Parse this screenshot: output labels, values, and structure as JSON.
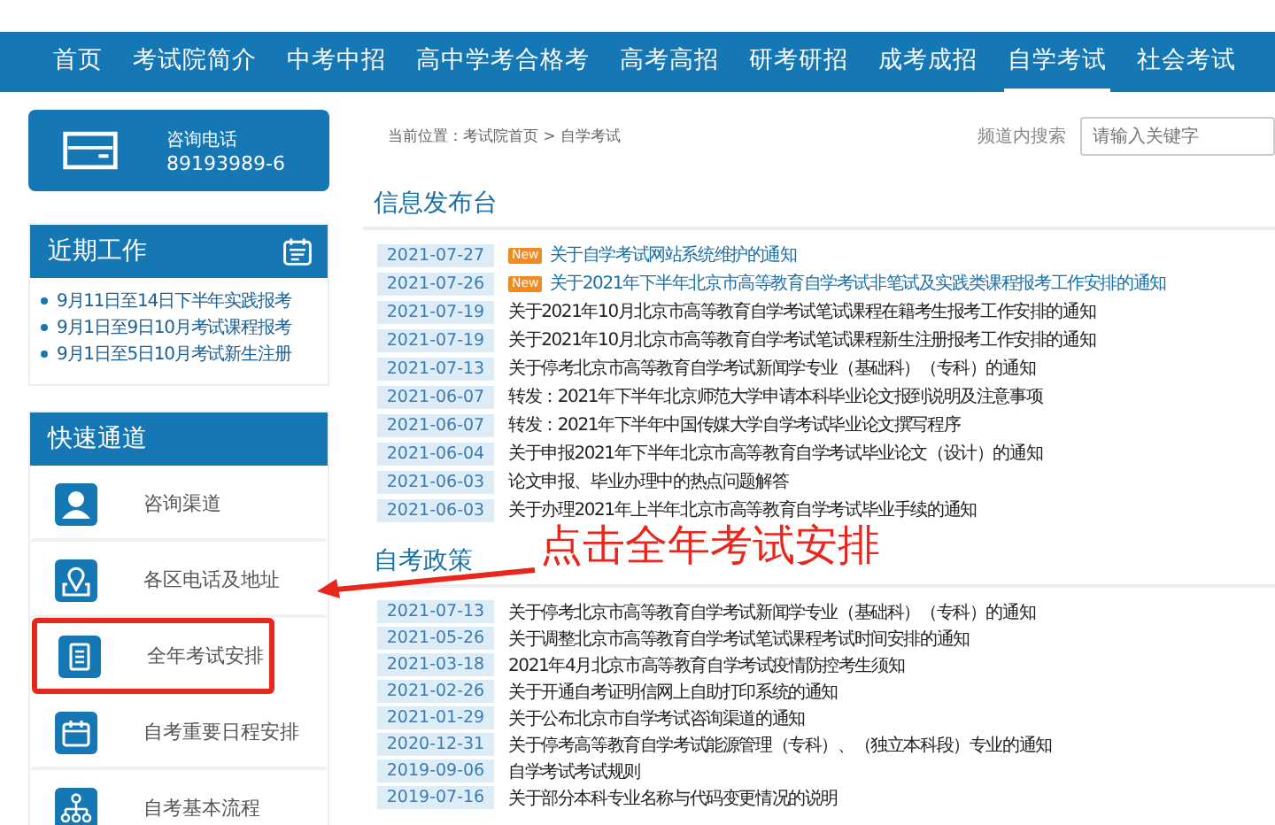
{
  "nav": [
    {
      "label": "首页",
      "selected": false
    },
    {
      "label": "考试院简介",
      "selected": false
    },
    {
      "label": "中考中招",
      "selected": false
    },
    {
      "label": "高中学考合格考",
      "selected": false
    },
    {
      "label": "高考高招",
      "selected": false
    },
    {
      "label": "研考研招",
      "selected": false
    },
    {
      "label": "成考成招",
      "selected": false
    },
    {
      "label": "自学考试",
      "selected": true
    },
    {
      "label": "社会考试",
      "selected": false
    }
  ],
  "hotline": {
    "label": "咨询电话",
    "number": "89193989-6"
  },
  "recent_work": {
    "title": "近期工作",
    "items": [
      "9月11日至14日下半年实践报考",
      "9月1日至9日10月考试课程报考",
      "9月1日至5日10月考试新生注册"
    ]
  },
  "quick_links": {
    "title": "快速通道",
    "items": [
      {
        "label": "咨询渠道",
        "kind": "person",
        "highlighted": false
      },
      {
        "label": "各区电话及地址",
        "kind": "map",
        "highlighted": false
      },
      {
        "label": "全年考试安排",
        "kind": "document",
        "highlighted": true
      },
      {
        "label": "自考重要日程安排",
        "kind": "calendar",
        "highlighted": false
      },
      {
        "label": "自考基本流程",
        "kind": "flow",
        "highlighted": false
      }
    ]
  },
  "breadcrumb": "当前位置：考试院首页 > 自学考试",
  "search": {
    "label": "频道内搜索",
    "placeholder": "请输入关键字"
  },
  "sections": [
    {
      "title": "信息发布台",
      "rows": [
        {
          "date": "2021-07-27",
          "new": true,
          "badge": "New",
          "title": "关于自学考试网站系统维护的通知"
        },
        {
          "date": "2021-07-26",
          "new": true,
          "badge": "New",
          "title": "关于2021年下半年北京市高等教育自学考试非笔试及实践类课程报考工作安排的通知"
        },
        {
          "date": "2021-07-19",
          "new": false,
          "title": "关于2021年10月北京市高等教育自学考试笔试课程在籍考生报考工作安排的通知"
        },
        {
          "date": "2021-07-19",
          "new": false,
          "title": "关于2021年10月北京市高等教育自学考试笔试课程新生注册报考工作安排的通知"
        },
        {
          "date": "2021-07-13",
          "new": false,
          "title": "关于停考北京市高等教育自学考试新闻学专业（基础科）（专科）的通知"
        },
        {
          "date": "2021-06-07",
          "new": false,
          "title": "转发：2021年下半年北京师范大学申请本科毕业论文报到说明及注意事项"
        },
        {
          "date": "2021-06-07",
          "new": false,
          "title": "转发：2021年下半年中国传媒大学自学考试毕业论文撰写程序"
        },
        {
          "date": "2021-06-04",
          "new": false,
          "title": "关于申报2021年下半年北京市高等教育自学考试毕业论文（设计）的通知"
        },
        {
          "date": "2021-06-03",
          "new": false,
          "title": "论文申报、毕业办理中的热点问题解答"
        },
        {
          "date": "2021-06-03",
          "new": false,
          "title": "关于办理2021年上半年北京市高等教育自学考试毕业手续的通知"
        }
      ]
    },
    {
      "title": "自考政策",
      "rows": [
        {
          "date": "2021-07-13",
          "new": false,
          "title": "关于停考北京市高等教育自学考试新闻学专业（基础科）（专科）的通知"
        },
        {
          "date": "2021-05-26",
          "new": false,
          "title": "关于调整北京市高等教育自学考试笔试课程考试时间安排的通知"
        },
        {
          "date": "2021-03-18",
          "new": false,
          "title": "2021年4月北京市高等教育自学考试疫情防控考生须知"
        },
        {
          "date": "2021-02-26",
          "new": false,
          "title": "关于开通自考证明信网上自助打印系统的通知"
        },
        {
          "date": "2021-01-29",
          "new": false,
          "title": "关于公布北京市自学考试咨询渠道的通知"
        },
        {
          "date": "2020-12-31",
          "new": false,
          "title": "关于停考高等教育自学考试能源管理（专科）、（独立本科段）专业的通知"
        },
        {
          "date": "2019-09-06",
          "new": false,
          "title": "自学考试考试规则"
        },
        {
          "date": "2019-07-16",
          "new": false,
          "title": "关于部分本科专业名称与代码变更情况的说明"
        }
      ]
    }
  ],
  "annotation": {
    "text": "点击全年考试安排"
  }
}
